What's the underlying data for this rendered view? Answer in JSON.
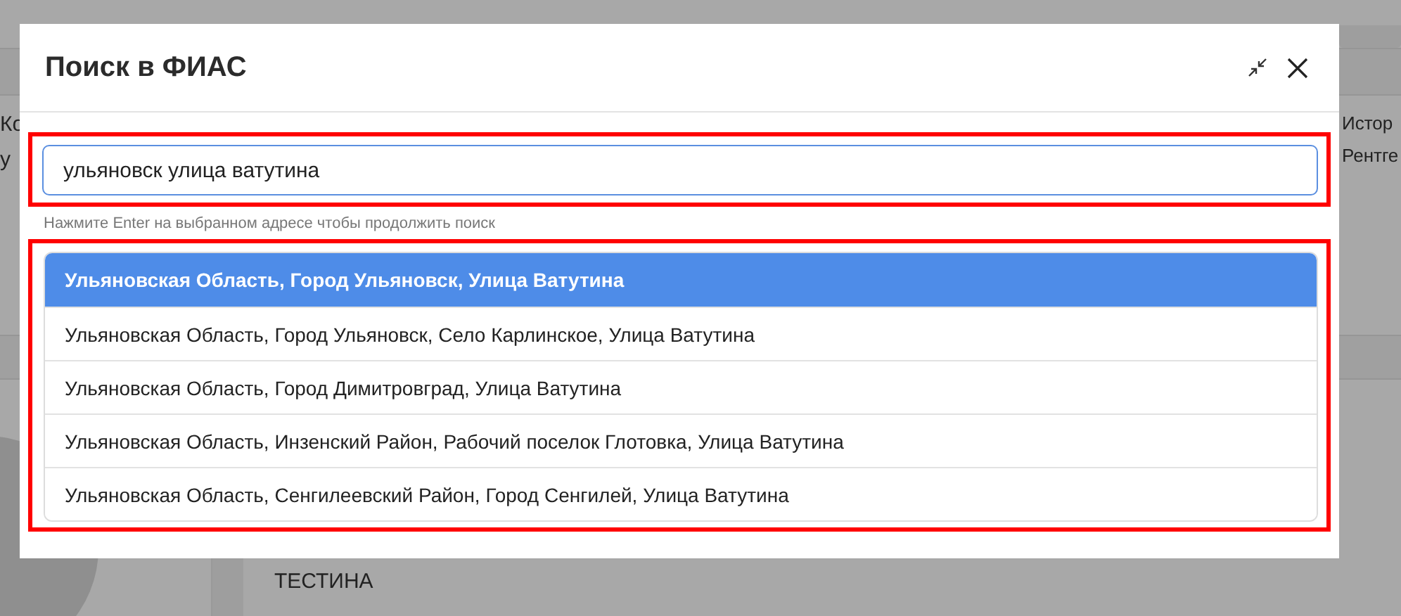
{
  "background": {
    "left_texts": [
      "Ко",
      "у"
    ],
    "right_texts": [
      "Истор",
      "Рентге"
    ],
    "bottom_text": "ТЕСТИНА"
  },
  "dialog": {
    "title": "Поиск в ФИАС",
    "search": {
      "value": "ульяновск улица ватутина",
      "hint": "Нажмите Enter на выбранном адресе чтобы продолжить поиск"
    },
    "results": [
      {
        "text": "Ульяновская Область, Город Ульяновск, Улица Ватутина",
        "selected": true
      },
      {
        "text": "Ульяновская Область, Город Ульяновск, Село Карлинское, Улица Ватутина",
        "selected": false
      },
      {
        "text": "Ульяновская Область, Город Димитровград, Улица Ватутина",
        "selected": false
      },
      {
        "text": "Ульяновская Область, Инзенский Район, Рабочий поселок Глотовка, Улица Ватутина",
        "selected": false
      },
      {
        "text": "Ульяновская Область, Сенгилеевский Район, Город Сенгилей, Улица Ватутина",
        "selected": false
      }
    ]
  }
}
